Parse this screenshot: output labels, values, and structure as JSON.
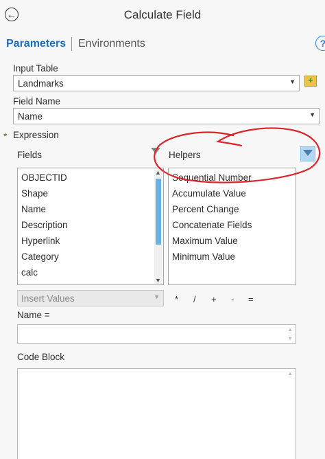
{
  "header": {
    "title": "Calculate Field",
    "back_icon": "←",
    "help_icon": "?"
  },
  "tabs": [
    {
      "label": "Parameters",
      "active": true
    },
    {
      "label": "Environments",
      "active": false
    }
  ],
  "input_table": {
    "label": "Input Table",
    "value": "Landmarks"
  },
  "field_name": {
    "label": "Field Name",
    "value": "Name"
  },
  "expression": {
    "label": "Expression",
    "required_marker": "*"
  },
  "fields": {
    "label": "Fields",
    "items": [
      "OBJECTID",
      "Shape",
      "Name",
      "Description",
      "Hyperlink",
      "Category",
      "calc"
    ]
  },
  "helpers": {
    "label": "Helpers",
    "items": [
      "Sequential Number",
      "Accumulate Value",
      "Percent Change",
      "Concatenate Fields",
      "Maximum Value",
      "Minimum Value"
    ]
  },
  "insert_values": {
    "label": "Insert Values"
  },
  "operators": [
    "*",
    "/",
    "+",
    "-",
    "="
  ],
  "expression_field": {
    "label": "Name =",
    "value": ""
  },
  "code_block": {
    "label": "Code Block",
    "value": ""
  },
  "colors": {
    "accent": "#1a6fc2",
    "annotation": "#d9262c",
    "scroll_thumb": "#6ab0e0"
  }
}
